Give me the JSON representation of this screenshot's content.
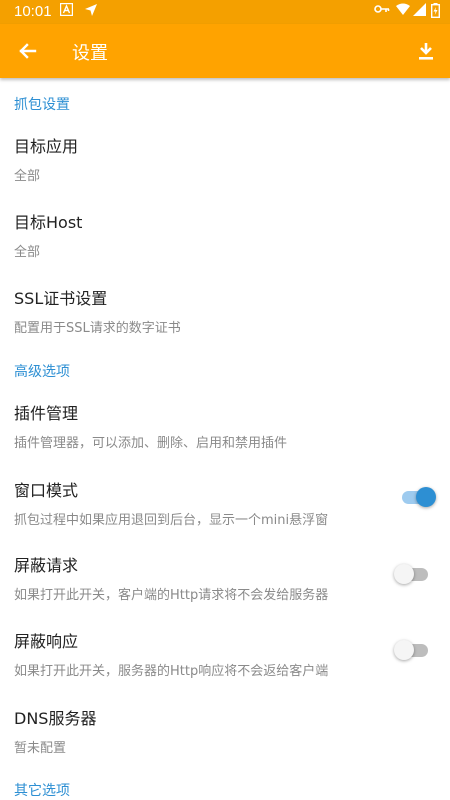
{
  "status_bar": {
    "time": "10:01"
  },
  "app_bar": {
    "title": "设置"
  },
  "colors": {
    "accent": "#ffa300",
    "section": "#2d8fd3",
    "switch_on": "#2d8fd3"
  },
  "sections": {
    "capture": "抓包设置",
    "advanced": "高级选项",
    "other": "其它选项"
  },
  "items": {
    "target_app": {
      "title": "目标应用",
      "summary": "全部"
    },
    "target_host": {
      "title": "目标Host",
      "summary": "全部"
    },
    "ssl": {
      "title": "SSL证书设置",
      "summary": "配置用于SSL请求的数字证书"
    },
    "plugins": {
      "title": "插件管理",
      "summary": "插件管理器，可以添加、删除、启用和禁用插件"
    },
    "window_mode": {
      "title": "窗口模式",
      "summary": "抓包过程中如果应用退回到后台，显示一个mini悬浮窗",
      "enabled": true
    },
    "block_request": {
      "title": "屏蔽请求",
      "summary": "如果打开此开关，客户端的Http请求将不会发给服务器",
      "enabled": false
    },
    "block_response": {
      "title": "屏蔽响应",
      "summary": "如果打开此开关，服务器的Http响应将不会返给客户端",
      "enabled": false
    },
    "dns": {
      "title": "DNS服务器",
      "summary": "暂未配置"
    }
  }
}
